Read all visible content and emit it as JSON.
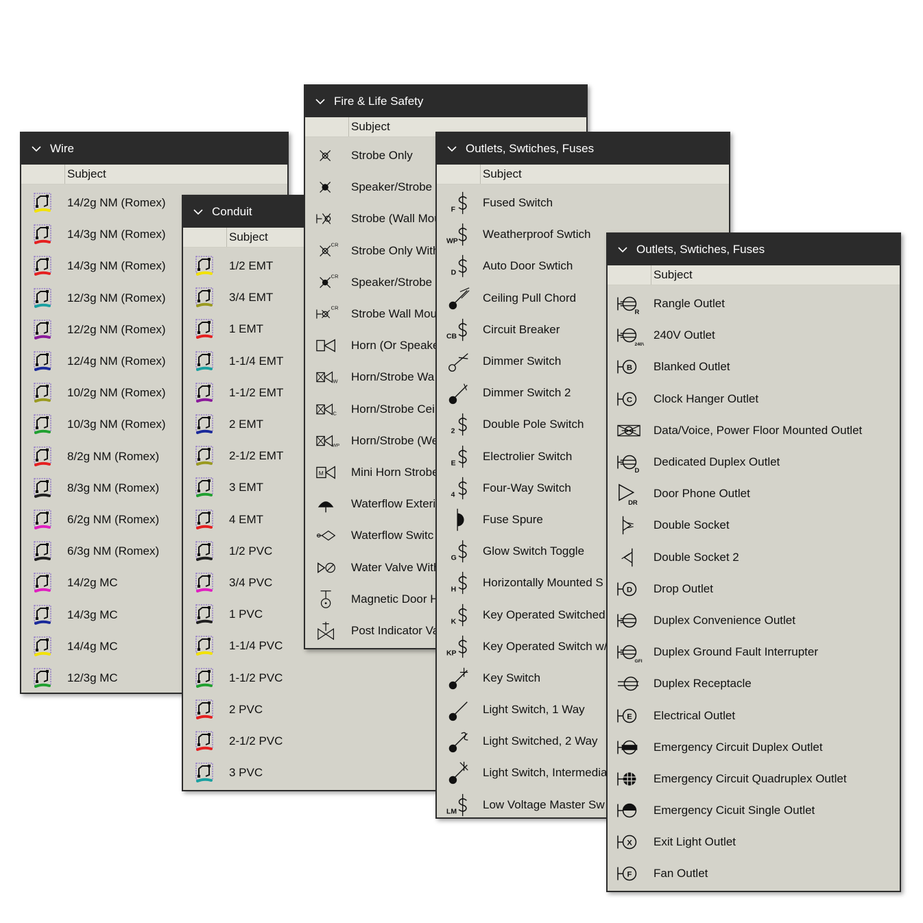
{
  "colors": {
    "header_bg": "#2b2b2b",
    "panel_bg": "#d4d3ca"
  },
  "column_header": "Subject",
  "wire": {
    "title": "Wire",
    "items": [
      {
        "label": "14/2g NM (Romex)",
        "color": "#f2e200"
      },
      {
        "label": "14/3g NM (Romex)",
        "color": "#e52020"
      },
      {
        "label": "14/3g NM (Romex)",
        "color": "#e52020"
      },
      {
        "label": "12/3g NM (Romex)",
        "color": "#1aa0a0"
      },
      {
        "label": "12/2g NM (Romex)",
        "color": "#8a1a9a"
      },
      {
        "label": "12/4g NM (Romex)",
        "color": "#1a2a9a"
      },
      {
        "label": "10/2g NM (Romex)",
        "color": "#9a9a20"
      },
      {
        "label": "10/3g NM (Romex)",
        "color": "#20a030"
      },
      {
        "label": "8/2g NM (Romex)",
        "color": "#e52020"
      },
      {
        "label": "8/3g NM (Romex)",
        "color": "#202020"
      },
      {
        "label": "6/2g NM (Romex)",
        "color": "#e020c0"
      },
      {
        "label": "6/3g NM (Romex)",
        "color": "#202020"
      },
      {
        "label": "14/2g MC",
        "color": "#e020c0"
      },
      {
        "label": "14/3g MC",
        "color": "#1a2a9a"
      },
      {
        "label": "14/4g MC",
        "color": "#f2e200"
      },
      {
        "label": "12/3g MC",
        "color": "#20a030"
      }
    ]
  },
  "conduit": {
    "title": "Conduit",
    "items": [
      {
        "label": "1/2 EMT",
        "color": "#f2e200"
      },
      {
        "label": "3/4 EMT",
        "color": "#9a9a20"
      },
      {
        "label": "1 EMT",
        "color": "#e52020"
      },
      {
        "label": "1-1/4 EMT",
        "color": "#1aa0a0"
      },
      {
        "label": "1-1/2 EMT",
        "color": "#8a1a9a"
      },
      {
        "label": "2 EMT",
        "color": "#1a2a9a"
      },
      {
        "label": "2-1/2 EMT",
        "color": "#9a9a20"
      },
      {
        "label": "3 EMT",
        "color": "#20a030"
      },
      {
        "label": "4 EMT",
        "color": "#e52020"
      },
      {
        "label": "1/2 PVC",
        "color": "#202020"
      },
      {
        "label": "3/4 PVC",
        "color": "#e020c0"
      },
      {
        "label": "1 PVC",
        "color": "#202020"
      },
      {
        "label": "1-1/4 PVC",
        "color": "#f2e200"
      },
      {
        "label": "1-1/2 PVC",
        "color": "#20a030"
      },
      {
        "label": "2 PVC",
        "color": "#e52020"
      },
      {
        "label": "2-1/2 PVC",
        "color": "#e52020"
      },
      {
        "label": "3 PVC",
        "color": "#1aa0a0"
      }
    ]
  },
  "fire": {
    "title": "Fire & Life Safety",
    "items": [
      {
        "label": "Strobe Only",
        "icon": "strobe"
      },
      {
        "label": "Speaker/Strobe",
        "icon": "speaker-strobe"
      },
      {
        "label": "Strobe (Wall Mou",
        "icon": "strobe-wall"
      },
      {
        "label": "Strobe Only With",
        "icon": "strobe-cr"
      },
      {
        "label": "Speaker/Strobe (",
        "icon": "speaker-strobe-cr"
      },
      {
        "label": "Strobe Wall Mou",
        "icon": "strobe-wall-cr"
      },
      {
        "label": "Horn (Or Speake",
        "icon": "horn"
      },
      {
        "label": "Horn/Strobe Wa",
        "icon": "horn-strobe-w"
      },
      {
        "label": "Horn/Strobe Ceil",
        "icon": "horn-strobe-c"
      },
      {
        "label": "Horn/Strobe (We",
        "icon": "horn-strobe-wp"
      },
      {
        "label": "Mini Horn Strobe",
        "icon": "mini-horn"
      },
      {
        "label": "Waterflow Exteri",
        "icon": "waterflow-ext"
      },
      {
        "label": "Waterflow Switc",
        "icon": "waterflow-switch"
      },
      {
        "label": "Water Valve With",
        "icon": "water-valve"
      },
      {
        "label": "Magnetic Door H",
        "icon": "magnetic-door"
      },
      {
        "label": "Post Indicator Va",
        "icon": "post-indicator"
      }
    ]
  },
  "switches": {
    "title": "Outlets, Swtiches, Fuses",
    "items": [
      {
        "label": "Fused Switch",
        "icon": "F"
      },
      {
        "label": "Weatherproof Swtich",
        "icon": "WP"
      },
      {
        "label": "Auto Door Swtich",
        "icon": "D"
      },
      {
        "label": "Ceiling Pull Chord",
        "icon": "pull"
      },
      {
        "label": "Circuit Breaker",
        "icon": "CB"
      },
      {
        "label": "Dimmer Switch",
        "icon": "dimmer"
      },
      {
        "label": "Dimmer Switch 2",
        "icon": "dimmer2"
      },
      {
        "label": "Double Pole Switch",
        "icon": "2"
      },
      {
        "label": "Electrolier Switch",
        "icon": "E"
      },
      {
        "label": "Four-Way Switch",
        "icon": "4"
      },
      {
        "label": "Fuse Spure",
        "icon": "fuse"
      },
      {
        "label": "Glow Switch Toggle",
        "icon": "G"
      },
      {
        "label": "Horizontally Mounted S",
        "icon": "H"
      },
      {
        "label": "Key Operated Switched",
        "icon": "K"
      },
      {
        "label": "Key Operated Switch w/",
        "icon": "KP"
      },
      {
        "label": "Key Switch",
        "icon": "key"
      },
      {
        "label": "Light Switch, 1 Way",
        "icon": "one-way"
      },
      {
        "label": "Light Switched, 2 Way",
        "icon": "two-way"
      },
      {
        "label": "Light Switch, Intermedia",
        "icon": "intermediate"
      },
      {
        "label": "Low Voltage Master Sw",
        "icon": "LM"
      }
    ]
  },
  "outlets": {
    "title": "Outlets, Swtiches, Fuses",
    "items": [
      {
        "label": "Rangle Outlet",
        "icon": "R"
      },
      {
        "label": "240V Outlet",
        "icon": "240V"
      },
      {
        "label": "Blanked Outlet",
        "icon": "B"
      },
      {
        "label": "Clock Hanger Outlet",
        "icon": "C"
      },
      {
        "label": "Data/Voice, Power Floor Mounted Outlet",
        "icon": "floor"
      },
      {
        "label": "Dedicated Duplex Outlet",
        "icon": "Dsub"
      },
      {
        "label": "Door Phone Outlet",
        "icon": "DR"
      },
      {
        "label": "Double Socket",
        "icon": "socket"
      },
      {
        "label": "Double Socket 2",
        "icon": "socket2"
      },
      {
        "label": "Drop Outlet",
        "icon": "Dc"
      },
      {
        "label": "Duplex Convenience Outlet",
        "icon": "duplex"
      },
      {
        "label": "Duplex Ground Fault Interrupter",
        "icon": "GFI"
      },
      {
        "label": "Duplex Receptacle",
        "icon": "receptacle"
      },
      {
        "label": "Electrical Outlet",
        "icon": "Ec"
      },
      {
        "label": "Emergency Circuit Duplex Outlet",
        "icon": "emer-duplex"
      },
      {
        "label": "Emergency Circuit Quadruplex Outlet",
        "icon": "emer-quad"
      },
      {
        "label": "Emergency Cicuit Single Outlet",
        "icon": "emer-single"
      },
      {
        "label": "Exit Light Outlet",
        "icon": "X"
      },
      {
        "label": "Fan Outlet",
        "icon": "Fc"
      }
    ]
  }
}
